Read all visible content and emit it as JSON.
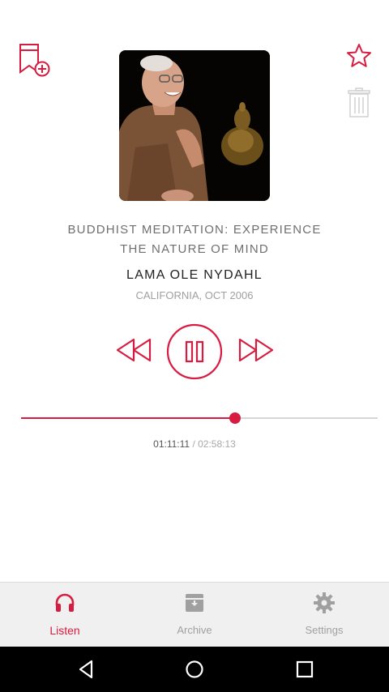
{
  "track": {
    "title_line1": "BUDDHIST MEDITATION: EXPERIENCE",
    "title_line2": "THE NATURE OF MIND",
    "artist": "LAMA OLE NYDAHL",
    "location": "CALIFORNIA, OCT 2006"
  },
  "playback": {
    "elapsed": "01:11:11",
    "separator": "/",
    "total": "02:58:13",
    "progress": 0.6,
    "state": "playing"
  },
  "tabs": [
    {
      "label": "Listen",
      "icon": "headphones-icon",
      "active": true
    },
    {
      "label": "Archive",
      "icon": "archive-icon",
      "active": false
    },
    {
      "label": "Settings",
      "icon": "gear-icon",
      "active": false
    }
  ],
  "colors": {
    "accent": "#d81b40",
    "inactive": "#a0a0a0",
    "track_bg": "#d6d6d6"
  }
}
